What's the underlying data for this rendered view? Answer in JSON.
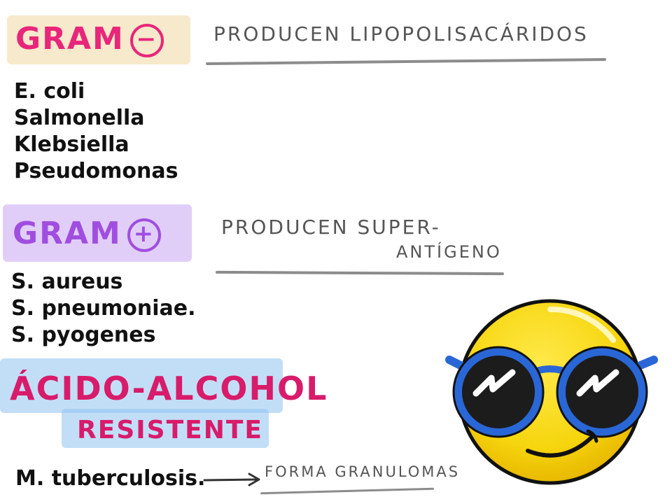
{
  "gram_negative": {
    "title": "GRAM",
    "sign": "−",
    "note": "Producen lipopolisacáridos",
    "organisms": [
      "E. coli",
      "Salmonella",
      "Klebsiella",
      "Pseudomonas"
    ],
    "color": "#e8267a",
    "highlight_color": "#f0d7a0"
  },
  "gram_positive": {
    "title": "GRAM",
    "sign": "+",
    "note_line1": "Producen super-",
    "note_line2": "antígeno",
    "organisms": [
      "S. aureus",
      "S. pneumoniae.",
      "S. pyogenes"
    ],
    "color": "#a04ee0",
    "highlight_color": "#c9a6f2"
  },
  "acid_fast": {
    "title_line1": "ÁCIDO-ALCOHOL",
    "title_line2": "RESISTENTE",
    "organism": "M. tuberculosis.",
    "note": "Forma granulomas",
    "color": "#d81b6a",
    "highlight_color": "#8fc3f0"
  },
  "emoji": {
    "name": "cool-smiley-emoji-icon"
  }
}
